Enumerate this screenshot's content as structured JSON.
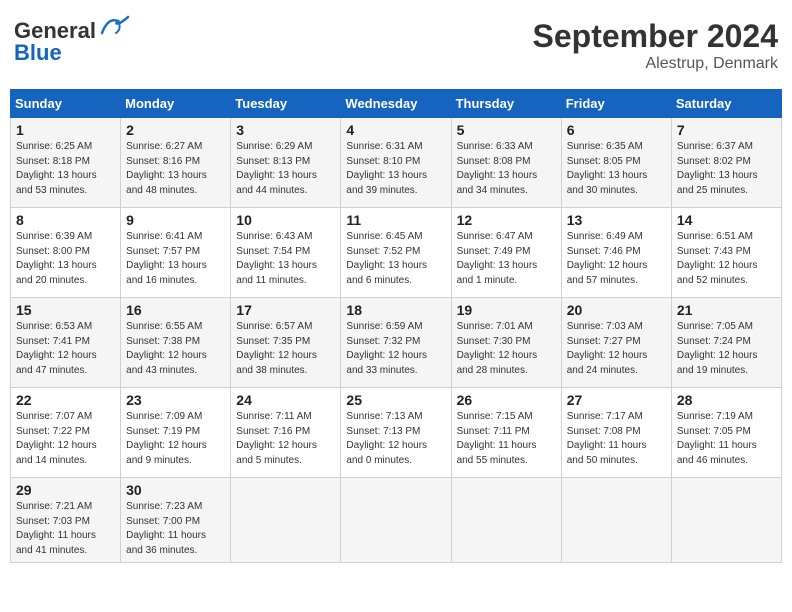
{
  "header": {
    "logo_line1": "General",
    "logo_line2": "Blue",
    "month": "September 2024",
    "location": "Alestrup, Denmark"
  },
  "days_of_week": [
    "Sunday",
    "Monday",
    "Tuesday",
    "Wednesday",
    "Thursday",
    "Friday",
    "Saturday"
  ],
  "weeks": [
    [
      {
        "day": "1",
        "sunrise": "6:25 AM",
        "sunset": "8:18 PM",
        "daylight": "13 hours and 53 minutes."
      },
      {
        "day": "2",
        "sunrise": "6:27 AM",
        "sunset": "8:16 PM",
        "daylight": "13 hours and 48 minutes."
      },
      {
        "day": "3",
        "sunrise": "6:29 AM",
        "sunset": "8:13 PM",
        "daylight": "13 hours and 44 minutes."
      },
      {
        "day": "4",
        "sunrise": "6:31 AM",
        "sunset": "8:10 PM",
        "daylight": "13 hours and 39 minutes."
      },
      {
        "day": "5",
        "sunrise": "6:33 AM",
        "sunset": "8:08 PM",
        "daylight": "13 hours and 34 minutes."
      },
      {
        "day": "6",
        "sunrise": "6:35 AM",
        "sunset": "8:05 PM",
        "daylight": "13 hours and 30 minutes."
      },
      {
        "day": "7",
        "sunrise": "6:37 AM",
        "sunset": "8:02 PM",
        "daylight": "13 hours and 25 minutes."
      }
    ],
    [
      {
        "day": "8",
        "sunrise": "6:39 AM",
        "sunset": "8:00 PM",
        "daylight": "13 hours and 20 minutes."
      },
      {
        "day": "9",
        "sunrise": "6:41 AM",
        "sunset": "7:57 PM",
        "daylight": "13 hours and 16 minutes."
      },
      {
        "day": "10",
        "sunrise": "6:43 AM",
        "sunset": "7:54 PM",
        "daylight": "13 hours and 11 minutes."
      },
      {
        "day": "11",
        "sunrise": "6:45 AM",
        "sunset": "7:52 PM",
        "daylight": "13 hours and 6 minutes."
      },
      {
        "day": "12",
        "sunrise": "6:47 AM",
        "sunset": "7:49 PM",
        "daylight": "13 hours and 1 minute."
      },
      {
        "day": "13",
        "sunrise": "6:49 AM",
        "sunset": "7:46 PM",
        "daylight": "12 hours and 57 minutes."
      },
      {
        "day": "14",
        "sunrise": "6:51 AM",
        "sunset": "7:43 PM",
        "daylight": "12 hours and 52 minutes."
      }
    ],
    [
      {
        "day": "15",
        "sunrise": "6:53 AM",
        "sunset": "7:41 PM",
        "daylight": "12 hours and 47 minutes."
      },
      {
        "day": "16",
        "sunrise": "6:55 AM",
        "sunset": "7:38 PM",
        "daylight": "12 hours and 43 minutes."
      },
      {
        "day": "17",
        "sunrise": "6:57 AM",
        "sunset": "7:35 PM",
        "daylight": "12 hours and 38 minutes."
      },
      {
        "day": "18",
        "sunrise": "6:59 AM",
        "sunset": "7:32 PM",
        "daylight": "12 hours and 33 minutes."
      },
      {
        "day": "19",
        "sunrise": "7:01 AM",
        "sunset": "7:30 PM",
        "daylight": "12 hours and 28 minutes."
      },
      {
        "day": "20",
        "sunrise": "7:03 AM",
        "sunset": "7:27 PM",
        "daylight": "12 hours and 24 minutes."
      },
      {
        "day": "21",
        "sunrise": "7:05 AM",
        "sunset": "7:24 PM",
        "daylight": "12 hours and 19 minutes."
      }
    ],
    [
      {
        "day": "22",
        "sunrise": "7:07 AM",
        "sunset": "7:22 PM",
        "daylight": "12 hours and 14 minutes."
      },
      {
        "day": "23",
        "sunrise": "7:09 AM",
        "sunset": "7:19 PM",
        "daylight": "12 hours and 9 minutes."
      },
      {
        "day": "24",
        "sunrise": "7:11 AM",
        "sunset": "7:16 PM",
        "daylight": "12 hours and 5 minutes."
      },
      {
        "day": "25",
        "sunrise": "7:13 AM",
        "sunset": "7:13 PM",
        "daylight": "12 hours and 0 minutes."
      },
      {
        "day": "26",
        "sunrise": "7:15 AM",
        "sunset": "7:11 PM",
        "daylight": "11 hours and 55 minutes."
      },
      {
        "day": "27",
        "sunrise": "7:17 AM",
        "sunset": "7:08 PM",
        "daylight": "11 hours and 50 minutes."
      },
      {
        "day": "28",
        "sunrise": "7:19 AM",
        "sunset": "7:05 PM",
        "daylight": "11 hours and 46 minutes."
      }
    ],
    [
      {
        "day": "29",
        "sunrise": "7:21 AM",
        "sunset": "7:03 PM",
        "daylight": "11 hours and 41 minutes."
      },
      {
        "day": "30",
        "sunrise": "7:23 AM",
        "sunset": "7:00 PM",
        "daylight": "11 hours and 36 minutes."
      },
      null,
      null,
      null,
      null,
      null
    ]
  ]
}
